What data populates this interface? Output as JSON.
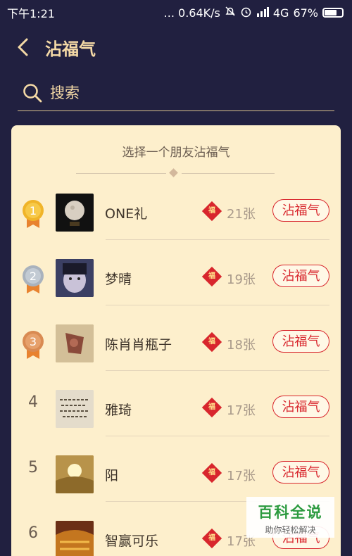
{
  "status_bar": {
    "time": "下午1:21",
    "network_speed": "... 0.64K/s",
    "signal": "4G",
    "battery": "67%"
  },
  "header": {
    "title": "沾福气"
  },
  "search": {
    "placeholder": "搜索"
  },
  "card": {
    "title": "选择一个朋友沾福气",
    "button_label": "沾福气",
    "rows": [
      {
        "rank": "1",
        "name": "ONE礼",
        "count": "21张",
        "medal": "gold"
      },
      {
        "rank": "2",
        "name": "梦晴",
        "count": "19张",
        "medal": "silver"
      },
      {
        "rank": "3",
        "name": "陈肖肖瓶子",
        "count": "18张",
        "medal": "bronze"
      },
      {
        "rank": "4",
        "name": "雅琦",
        "count": "17张",
        "medal": ""
      },
      {
        "rank": "5",
        "name": "阳",
        "count": "17张",
        "medal": ""
      },
      {
        "rank": "6",
        "name": "智赢可乐",
        "count": "17张",
        "medal": ""
      }
    ]
  },
  "fu_char": "福",
  "watermark": {
    "main": "百科全说",
    "sub": "助你轻松解决"
  },
  "colors": {
    "background": "#212040",
    "accent": "#f4d9a6",
    "card": "#fdefcc",
    "red": "#d8262d"
  }
}
